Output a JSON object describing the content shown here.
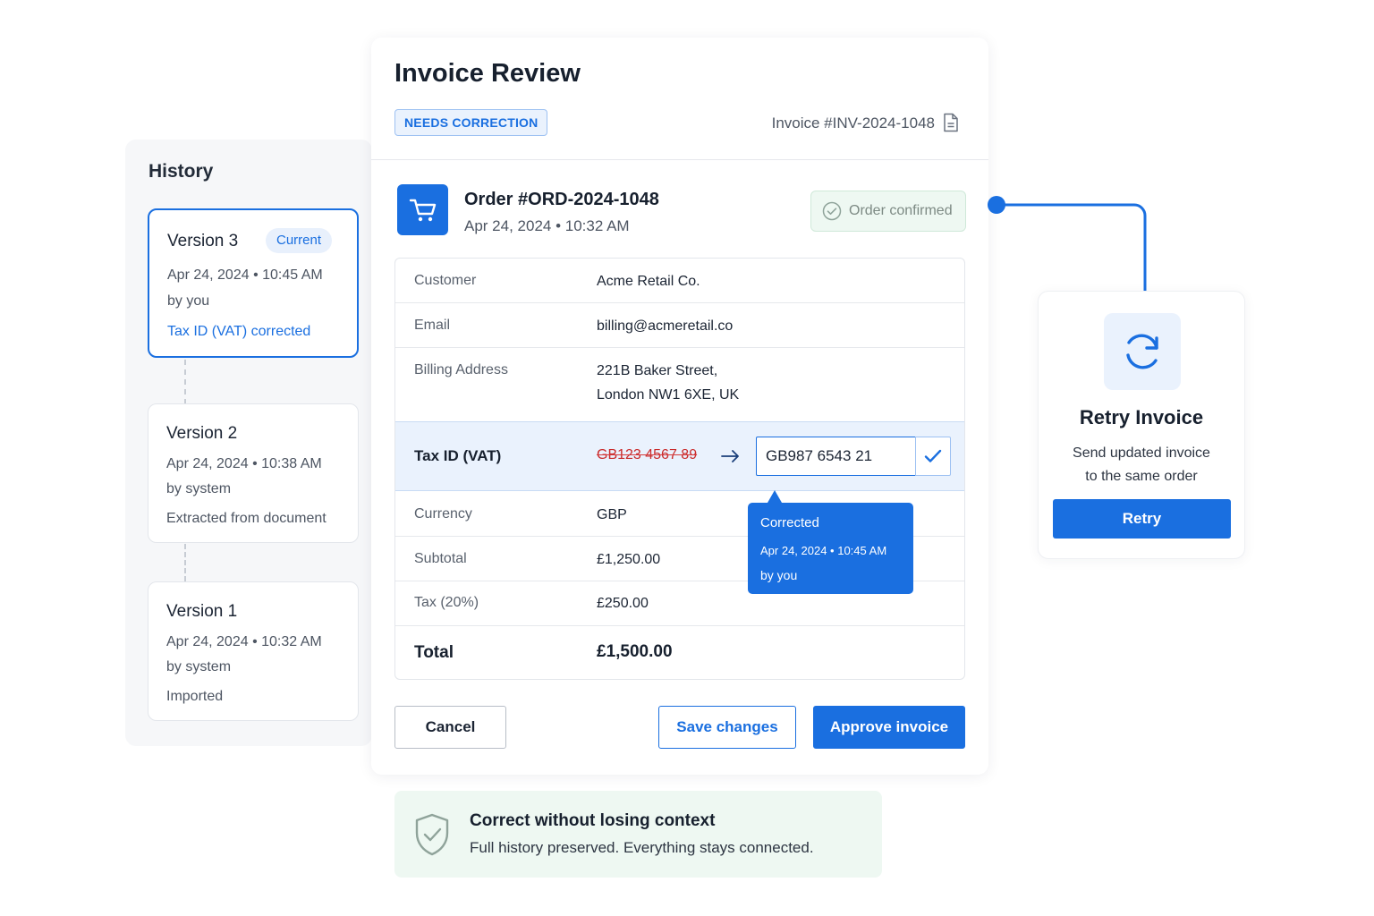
{
  "history": {
    "title": "History",
    "versions": [
      {
        "title": "Version 3",
        "badge": "Current",
        "date": "Apr 24, 2024 • 10:45 AM",
        "by": "by you",
        "note": "Tax ID (VAT) corrected"
      },
      {
        "title": "Version 2",
        "date": "Apr 24, 2024 • 10:38 AM",
        "by": "by system",
        "note": "Extracted from document"
      },
      {
        "title": "Version 1",
        "date": "Apr 24, 2024 • 10:32 AM",
        "by": "by system",
        "note": "Imported"
      }
    ]
  },
  "invoice": {
    "title": "Invoice Review",
    "status_tag": "NEEDS CORRECTION",
    "number": "Invoice #INV-2024-1048",
    "order": {
      "title": "Order #ORD-2024-1048",
      "date": "Apr 24, 2024 • 10:32 AM",
      "status": "Order confirmed"
    },
    "fields": {
      "customer": {
        "label": "Customer",
        "value": "Acme Retail Co."
      },
      "email": {
        "label": "Email",
        "value": "billing@acmeretail.co"
      },
      "address": {
        "label": "Billing Address",
        "line1": "221B Baker Street,",
        "line2": "London NW1 6XE, UK"
      },
      "tax_id": {
        "label": "Tax ID (VAT)",
        "old_value": "GB123 4567 89",
        "new_value": "GB987 6543 21"
      },
      "currency": {
        "label": "Currency",
        "value": "GBP"
      },
      "subtotal": {
        "label": "Subtotal",
        "value": "£1,250.00"
      },
      "tax": {
        "label": "Tax (20%)",
        "value": "£250.00"
      },
      "total": {
        "label": "Total",
        "value": "£1,500.00"
      }
    },
    "tooltip": {
      "title": "Corrected",
      "date": "Apr 24, 2024 • 10:45 AM",
      "by": "by you"
    },
    "buttons": {
      "cancel": "Cancel",
      "save": "Save changes",
      "approve": "Approve invoice"
    }
  },
  "retry": {
    "title": "Retry Invoice",
    "desc_line1": "Send updated invoice",
    "desc_line2": "to the same order",
    "button": "Retry"
  },
  "banner": {
    "title": "Correct without losing context",
    "subtitle": "Full history preserved. Everything stays connected."
  },
  "colors": {
    "accent": "#1a6fe0",
    "success_bg": "#eef8f2",
    "error": "#c92b2b"
  },
  "icons": [
    "cart-icon",
    "check-circle-icon",
    "document-icon",
    "arrow-right-icon",
    "checkmark-icon",
    "refresh-icon",
    "shield-check-icon"
  ]
}
